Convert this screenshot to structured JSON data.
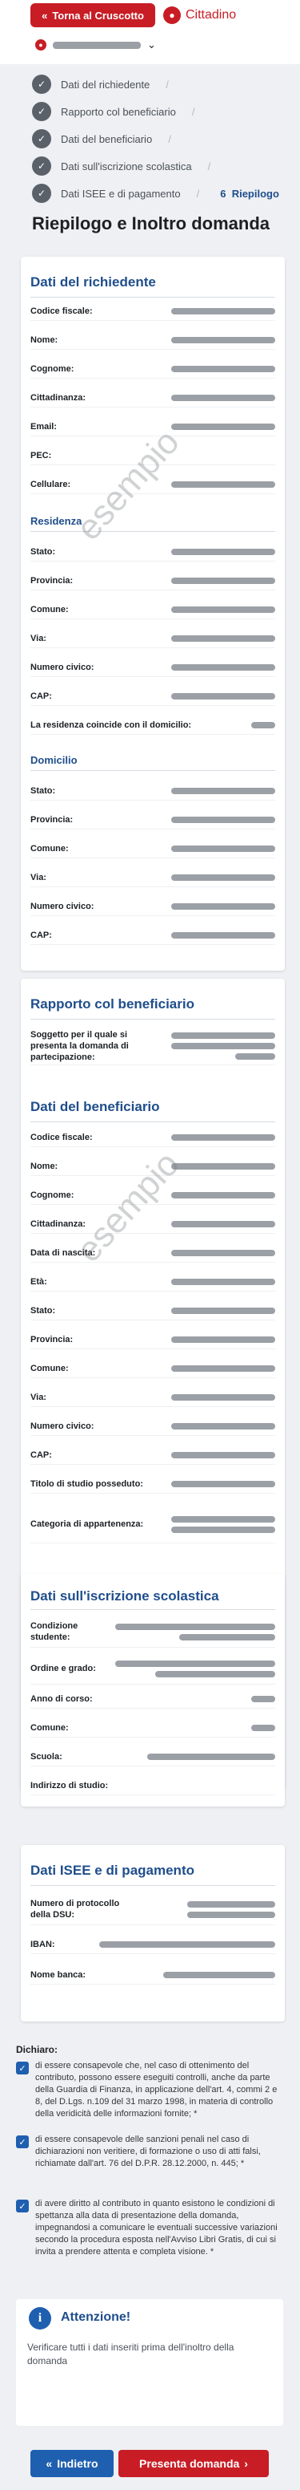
{
  "header": {
    "back_label": "Torna al Cruscotto",
    "back_icon": "double-chevron-left-icon",
    "role_label": "Cittadino",
    "role_icon": "user-icon"
  },
  "steps": [
    {
      "label": "Dati del richiedente"
    },
    {
      "label": "Rapporto col beneficiario"
    },
    {
      "label": "Dati del beneficiario"
    },
    {
      "label": "Dati sull'iscrizione scolastica"
    },
    {
      "label": "Dati ISEE e di pagamento"
    }
  ],
  "current_step": {
    "number": "6",
    "label": "Riepilogo"
  },
  "page_title": "Riepilogo e Inoltro domanda",
  "watermark": "esempio",
  "colors": {
    "brand_red": "#c81d25",
    "brand_blue": "#1f4e8c",
    "button_blue": "#1f5fb0"
  },
  "richiedente": {
    "title": "Dati del richiedente",
    "fields": [
      "Codice fiscale:",
      "Nome:",
      "Cognome:",
      "Cittadinanza:",
      "Email:",
      "PEC:",
      "Cellulare:"
    ],
    "residenza_title": "Residenza",
    "residenza_fields": [
      "Stato:",
      "Provincia:",
      "Comune:",
      "Via:",
      "Numero civico:",
      "CAP:",
      "La residenza coincide con il domicilio:"
    ],
    "domicilio_title": "Domicilio",
    "domicilio_fields": [
      "Stato:",
      "Provincia:",
      "Comune:",
      "Via:",
      "Numero civico:",
      "CAP:"
    ]
  },
  "rapporto": {
    "title": "Rapporto col beneficiario",
    "fields": [
      "Soggetto per il quale si presenta la domanda di partecipazione:"
    ]
  },
  "beneficiario": {
    "title": "Dati del beneficiario",
    "fields": [
      "Codice fiscale:",
      "Nome:",
      "Cognome:",
      "Cittadinanza:",
      "Data di nascita:",
      "Età:",
      "Stato:",
      "Provincia:",
      "Comune:",
      "Via:",
      "Numero civico:",
      "CAP:",
      "Titolo di studio posseduto:",
      "Categoria di appartenenza:"
    ]
  },
  "scolastica": {
    "title": "Dati sull'iscrizione scolastica",
    "fields": [
      "Condizione studente:",
      "Ordine e grado:",
      "Anno di corso:",
      "Comune:",
      "Scuola:",
      "Indirizzo di studio:"
    ]
  },
  "isee": {
    "title": "Dati ISEE e di pagamento",
    "fields": [
      "Numero di protocollo della DSU:",
      "IBAN:",
      "Nome banca:"
    ]
  },
  "dichiaro": {
    "title": "Dichiaro:",
    "items": [
      "di essere consapevole che, nel caso di ottenimento del contributo, possono essere eseguiti controlli, anche da parte della Guardia di Finanza, in applicazione dell'art. 4, commi 2 e 8, del D.Lgs. n.109 del 31 marzo 1998, in materia di controllo della veridicità delle informazioni fornite; *",
      "di essere consapevole delle sanzioni penali nel caso di dichiarazioni non veritiere, di formazione o uso di atti falsi, richiamate dall'art. 76 del D.P.R. 28.12.2000, n. 445; *",
      "di avere diritto al contributo in quanto esistono le condizioni di spettanza alla data di presentazione della domanda, impegnandosi a comunicare le eventuali successive variazioni secondo la procedura esposta nell'Avviso Libri Gratis, di cui si invita a prendere attenta e completa visione. *"
    ]
  },
  "alert": {
    "title": "Attenzione!",
    "text": "Verificare tutti i dati inseriti prima dell'inoltro della domanda",
    "icon": "info-icon"
  },
  "footer": {
    "back_label": "Indietro",
    "back_icon": "double-chevron-left-icon",
    "submit_label": "Presenta domanda",
    "submit_icon": "chevron-right-icon"
  }
}
